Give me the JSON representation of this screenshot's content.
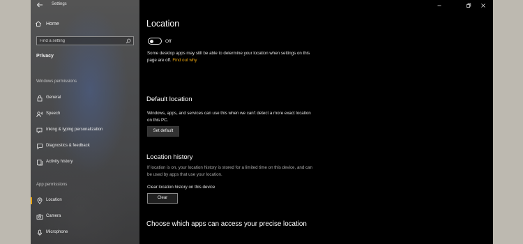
{
  "app": {
    "title": "Settings"
  },
  "sidebar": {
    "home_label": "Home",
    "search_placeholder": "Find a setting",
    "section": "Privacy",
    "windows_permissions_label": "Windows permissions",
    "windows_items": [
      {
        "label": "General",
        "icon": "lock-icon"
      },
      {
        "label": "Speech",
        "icon": "speech-icon"
      },
      {
        "label": "Inking & typing personalization",
        "icon": "pen-icon"
      },
      {
        "label": "Diagnostics & feedback",
        "icon": "feedback-icon"
      },
      {
        "label": "Activity history",
        "icon": "history-icon"
      }
    ],
    "app_permissions_label": "App permissions",
    "app_items": [
      {
        "label": "Location",
        "icon": "location-icon",
        "active": true
      },
      {
        "label": "Camera",
        "icon": "camera-icon",
        "active": false
      },
      {
        "label": "Microphone",
        "icon": "microphone-icon",
        "active": false
      }
    ]
  },
  "main": {
    "title": "Location",
    "toggle": {
      "state": "Off",
      "on": false
    },
    "desktop_note": "Some desktop apps may still be able to determine your location when settings on this page are off.",
    "find_out_why": "Find out why",
    "default_location": {
      "heading": "Default location",
      "description": "Windows, apps, and services can use this when we can't detect a more exact location on this PC.",
      "button": "Set default"
    },
    "location_history": {
      "heading": "Location history",
      "description": "If location is on, your location history is stored for a limited time on this device, and can be used by apps that use your location.",
      "clear_label": "Clear location history on this device",
      "button": "Clear"
    },
    "choose_apps_heading": "Choose which apps can access your precise location"
  },
  "colors": {
    "accent": "#e8a20c",
    "background": "#000000",
    "sidebar": "#4b4c4e"
  }
}
